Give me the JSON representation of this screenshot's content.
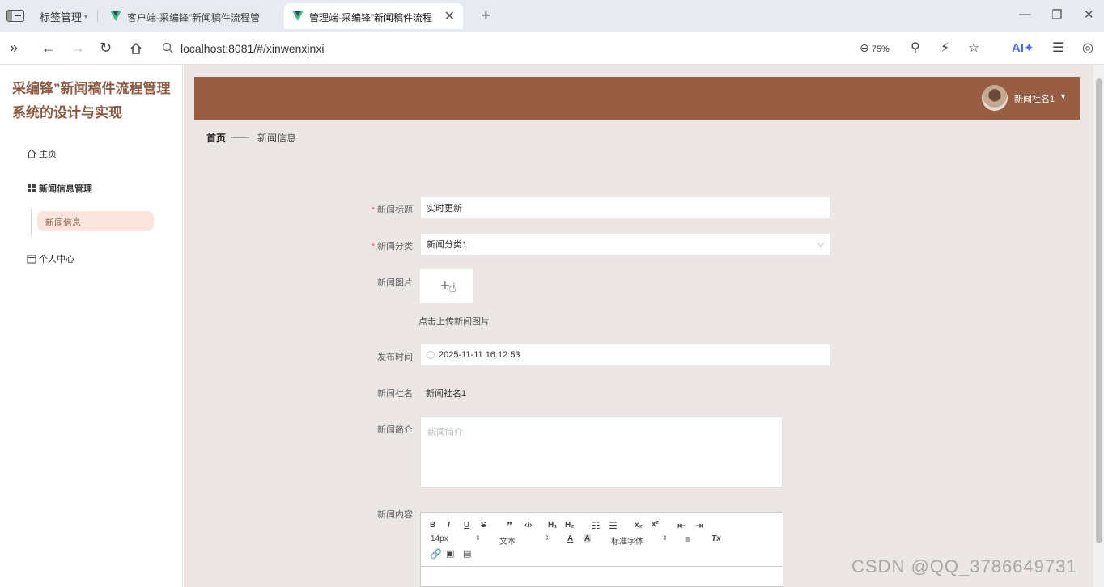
{
  "browser": {
    "tab_group": "标签管理",
    "tabs": [
      {
        "title": "客户端-采编锋”新闻稿件流程管"
      },
      {
        "title": "管理端-采编锋”新闻稿件流程",
        "active": true
      }
    ],
    "url": "localhost:8081/#/xinwenxinxi",
    "zoom": "75%",
    "ai_label": "AI"
  },
  "sidebar": {
    "title": "采编锋”新闻稿件流程管理系统的设计与实现",
    "items": [
      {
        "label": "主页"
      },
      {
        "label": "新闻信息管理"
      },
      {
        "label": "个人中心"
      }
    ],
    "sub_items": [
      {
        "label": "新闻信息"
      }
    ]
  },
  "header": {
    "user_name": "新闻社名1"
  },
  "breadcrumb": {
    "home": "首页",
    "separator": "——",
    "current": "新闻信息"
  },
  "form": {
    "title_label": "新闻标题",
    "title_value": "实时更新",
    "category_label": "新闻分类",
    "category_value": "新闻分类1",
    "image_label": "新闻图片",
    "upload_hint": "点击上传新闻图片",
    "time_label": "发布时间",
    "time_value": "2025-11-11 16:12:53",
    "publisher_label": "新闻社名",
    "publisher_value": "新闻社名1",
    "intro_label": "新闻简介",
    "intro_placeholder": "新闻简介",
    "content_label": "新闻内容"
  },
  "editor": {
    "font_size": "14px",
    "paragraph": "文本",
    "font_family": "标准字体"
  },
  "watermark": "CSDN @QQ_3786649731",
  "colors": {
    "brand": "#985d43",
    "title": "#8c5a43",
    "background": "#ece6e4",
    "submenu_active": "#fbe4dc"
  }
}
